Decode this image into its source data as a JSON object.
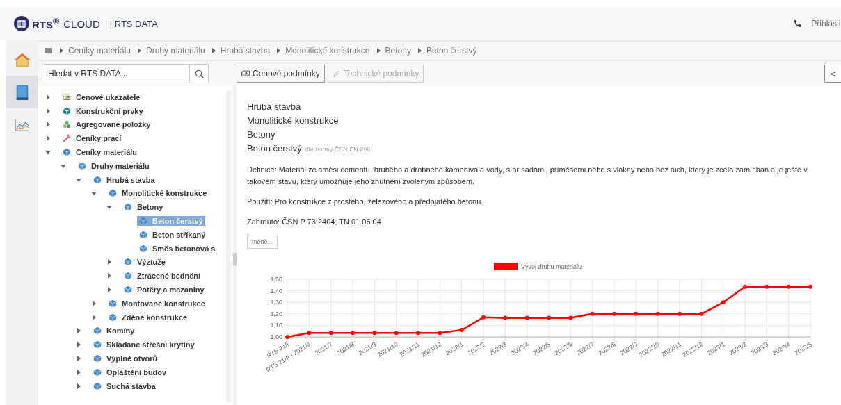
{
  "header": {
    "brand": "RTS$^{®}$",
    "product": "CLOUD",
    "section": "| RTS DATA",
    "login": "Přihlásit"
  },
  "rail": [
    {
      "kind": "home",
      "selected": false
    },
    {
      "kind": "book",
      "selected": true
    },
    {
      "kind": "chart",
      "selected": false
    }
  ],
  "breadcrumb": [
    "Ceníky materiálu",
    "Druhy materiálu",
    "Hrubá stavba",
    "Monolitické konstrukce",
    "Betony",
    "Beton čerstvý"
  ],
  "search": {
    "placeholder": "Hledat v RTS DATA..."
  },
  "toolbar": [
    {
      "label": "Cenové podmínky",
      "kind": "money",
      "disabled": false
    },
    {
      "label": "Technické podmínky",
      "kind": "pencil",
      "disabled": true
    }
  ],
  "tree": [
    {
      "label": "Cenové ukazatele",
      "kind": "list",
      "expanded": false,
      "selected": false
    },
    {
      "label": "Konstrukční prvky",
      "kind": "box",
      "expanded": false,
      "selected": false
    },
    {
      "label": "Agregované položky",
      "kind": "cubes",
      "expanded": false,
      "selected": false
    },
    {
      "label": "Ceníky prací",
      "kind": "wrench",
      "expanded": false,
      "selected": false
    },
    {
      "label": "Ceníky materiálu",
      "kind": "cube",
      "expanded": true,
      "selected": false,
      "children": [
        {
          "label": "Druhy materiálu",
          "kind": "cube",
          "expanded": true,
          "selected": false,
          "children": [
            {
              "label": "Hrubá stavba",
              "kind": "cube",
              "expanded": true,
              "selected": false,
              "children": [
                {
                  "label": "Monolitické konstrukce",
                  "kind": "cube",
                  "expanded": true,
                  "selected": false,
                  "children": [
                    {
                      "label": "Betony",
                      "kind": "cube",
                      "expanded": true,
                      "selected": false,
                      "children": [
                        {
                          "label": "Beton čerstvý",
                          "kind": "cube",
                          "selected": true
                        },
                        {
                          "label": "Beton stříkaný",
                          "kind": "cube",
                          "selected": false
                        },
                        {
                          "label": "Směs betonová s",
                          "kind": "cube",
                          "selected": false
                        }
                      ]
                    },
                    {
                      "label": "Výztuže",
                      "kind": "cube",
                      "expanded": false,
                      "selected": false
                    },
                    {
                      "label": "Ztracené bednění",
                      "kind": "cube",
                      "expanded": false,
                      "selected": false
                    },
                    {
                      "label": "Potěry a mazaniny",
                      "kind": "cube",
                      "expanded": false,
                      "selected": false
                    }
                  ]
                },
                {
                  "label": "Montované konstrukce",
                  "kind": "cube",
                  "expanded": false,
                  "selected": false
                },
                {
                  "label": "Zděné konstrukce",
                  "kind": "cube",
                  "expanded": false,
                  "selected": false
                }
              ]
            },
            {
              "label": "Komíny",
              "kind": "cube",
              "expanded": false,
              "selected": false
            },
            {
              "label": "Skládané střešní krytiny",
              "kind": "cube",
              "expanded": false,
              "selected": false
            },
            {
              "label": "Výplně otvorů",
              "kind": "cube",
              "expanded": false,
              "selected": false
            },
            {
              "label": "Opláštění budov",
              "kind": "cube",
              "expanded": false,
              "selected": false
            },
            {
              "label": "Suchá stavba",
              "kind": "cube",
              "expanded": false,
              "selected": false
            }
          ]
        }
      ]
    }
  ],
  "detail": {
    "path": [
      "Hrubá stavba",
      "Monolitické konstrukce",
      "Betony"
    ],
    "title": "Beton čerstvý",
    "norm": "dle normy ČSN EN 206",
    "paragraphs": [
      "Definice: Materiál ze směsi cementu, hrubého a drobného kameniva a vody, s přísadami, příměsemi nebo s vlákny nebo bez nich, který je zcela zamíchán a je ještě v takovém stavu, který umožňuje jeho zhutnění zvoleným způsobem.",
      "Použití: Pro konstrukce z prostého, železového a předpjatého betonu.",
      "Zahrnuto: ČSN P 73 2404; TN 01.05.04"
    ],
    "less_button": "méně...",
    "chart_data": {
      "type": "line",
      "grid": true,
      "categories": [
        "RTS 21/I",
        "RTS 21/II - 2021/6",
        "2021/7",
        "2021/8",
        "2021/9",
        "2021/10",
        "2021/11",
        "2021/12",
        "2022/1",
        "2022/2",
        "2022/3",
        "2022/4",
        "2022/5",
        "2022/6",
        "2022/7",
        "2022/8",
        "2022/9",
        "2022/10",
        "2022/11",
        "2022/12",
        "2023/1",
        "2023/2",
        "2023/3",
        "2023/4",
        "2023/5"
      ],
      "series": [
        {
          "name": "Vývoj druhu materiálu",
          "color": "#ff0000",
          "marker": "circle",
          "values": [
            1.0,
            1.035,
            1.035,
            1.035,
            1.035,
            1.035,
            1.035,
            1.035,
            1.06,
            1.17,
            1.165,
            1.165,
            1.165,
            1.165,
            1.2,
            1.2,
            1.2,
            1.2,
            1.2,
            1.2,
            1.3,
            1.435,
            1.435,
            1.435,
            1.435
          ]
        }
      ],
      "ylim": [
        1.0,
        1.5
      ],
      "yticks": [
        {
          "value": 1.0,
          "label": "1,00"
        },
        {
          "value": 1.1,
          "label": "1,10"
        },
        {
          "value": 1.2,
          "label": "1,20"
        },
        {
          "value": 1.3,
          "label": "1,30"
        },
        {
          "value": 1.4,
          "label": "1,40"
        },
        {
          "value": 1.5,
          "label": "1,50"
        }
      ]
    }
  }
}
